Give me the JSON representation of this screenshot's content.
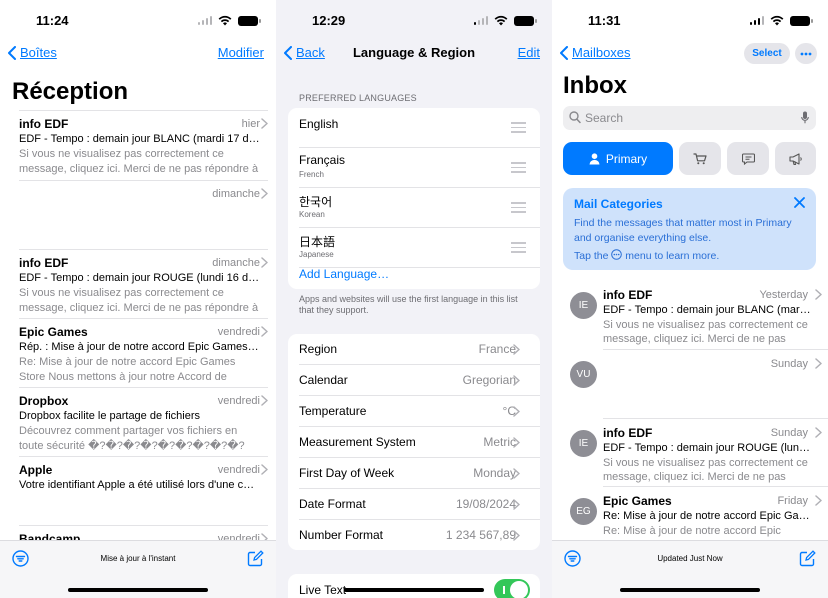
{
  "colors": {
    "accent": "#007aff",
    "toggle_on": "#34c759"
  },
  "panel1": {
    "time": "11:24",
    "back_label": "Boîtes",
    "right_action": "Modifier",
    "title": "Réception",
    "emails": [
      {
        "from": "info EDF",
        "date": "hier",
        "subject": "EDF - Tempo : demain jour BLANC (mardi 17 décembre)",
        "preview": "Si vous ne visualisez pas correctement ce message, cliquez ici. Merci de ne pas répondre à cet email"
      },
      {
        "from": "",
        "date": "dimanche",
        "subject": "",
        "preview": ""
      },
      {
        "from": "info EDF",
        "date": "dimanche",
        "subject": "EDF - Tempo : demain jour ROUGE (lundi 16 décembre)",
        "preview": "Si vous ne visualisez pas correctement ce message, cliquez ici. Merci de ne pas répondre à cet email"
      },
      {
        "from": "Epic Games",
        "date": "vendredi",
        "subject": "Rép. : Mise à jour de notre accord Epic Games Store",
        "preview": "Re: Mise à jour de notre accord Epic Games Store Nous mettons à jour notre Accord de licence d'utilisateur"
      },
      {
        "from": "Dropbox",
        "date": "vendredi",
        "subject": "Dropbox facilite le partage de fichiers",
        "preview": "Découvrez comment partager vos fichiers en toute sécurité �?�?�?�?�?�?�?�?�?�?�?�?�?�?"
      },
      {
        "from": "Apple",
        "date": "vendredi",
        "subject": "Votre identifiant Apple a été utilisé lors d'une connexion",
        "preview": ""
      },
      {
        "from": "Bandcamp",
        "date": "vendredi",
        "subject": "",
        "preview": ""
      }
    ],
    "status_text": "Mise à jour à l'instant"
  },
  "panel2": {
    "time": "12:29",
    "back_label": "Back",
    "title": "Language & Region",
    "right_action": "Edit",
    "preferred_header": "PREFERRED LANGUAGES",
    "languages": [
      {
        "name": "English",
        "sub": ""
      },
      {
        "name": "Français",
        "sub": "French"
      },
      {
        "name": "한국어",
        "sub": "Korean"
      },
      {
        "name": "日本語",
        "sub": "Japanese"
      }
    ],
    "add_language": "Add Language…",
    "footnote": "Apps and websites will use the first language in this list that they support.",
    "settings": [
      {
        "label": "Region",
        "value": "France"
      },
      {
        "label": "Calendar",
        "value": "Gregorian"
      },
      {
        "label": "Temperature",
        "value": "°C"
      },
      {
        "label": "Measurement System",
        "value": "Metric"
      },
      {
        "label": "First Day of Week",
        "value": "Monday"
      },
      {
        "label": "Date Format",
        "value": "19/08/2024"
      },
      {
        "label": "Number Format",
        "value": "1 234 567,89"
      }
    ],
    "live_text_label": "Live Text",
    "live_text_on": true
  },
  "panel3": {
    "time": "11:31",
    "back_label": "Mailboxes",
    "select_label": "Select",
    "title": "Inbox",
    "search_placeholder": "Search",
    "primary_label": "Primary",
    "categories_icons": [
      "cart-icon",
      "chat-icon",
      "megaphone-icon"
    ],
    "info": {
      "title": "Mail Categories",
      "body": "Find the messages that matter most in Primary and organise everything else.",
      "tap_prefix": "Tap the",
      "tap_suffix": "menu to learn more."
    },
    "emails": [
      {
        "initials": "IE",
        "from": "info EDF",
        "date": "Yesterday",
        "subject": "EDF - Tempo : demain jour BLANC (mardi 17 décembre)",
        "preview": "Si vous ne visualisez pas correctement ce message, cliquez ici. Merci de ne pas répondre à cet email"
      },
      {
        "initials": "VU",
        "from": "",
        "date": "Sunday",
        "subject": "",
        "preview": ""
      },
      {
        "initials": "IE",
        "from": "info EDF",
        "date": "Sunday",
        "subject": "EDF - Tempo : demain jour ROUGE (lundi 16 décembre)",
        "preview": "Si vous ne visualisez pas correctement ce message, cliquez ici. Merci de ne pas répondre à cet email"
      },
      {
        "initials": "EG",
        "from": "Epic Games",
        "date": "Friday",
        "subject": "Re: Mise à jour de notre accord Epic Games Store",
        "preview": "Re: Mise à jour de notre accord Epic Games Store"
      }
    ],
    "status_text": "Updated Just Now"
  }
}
